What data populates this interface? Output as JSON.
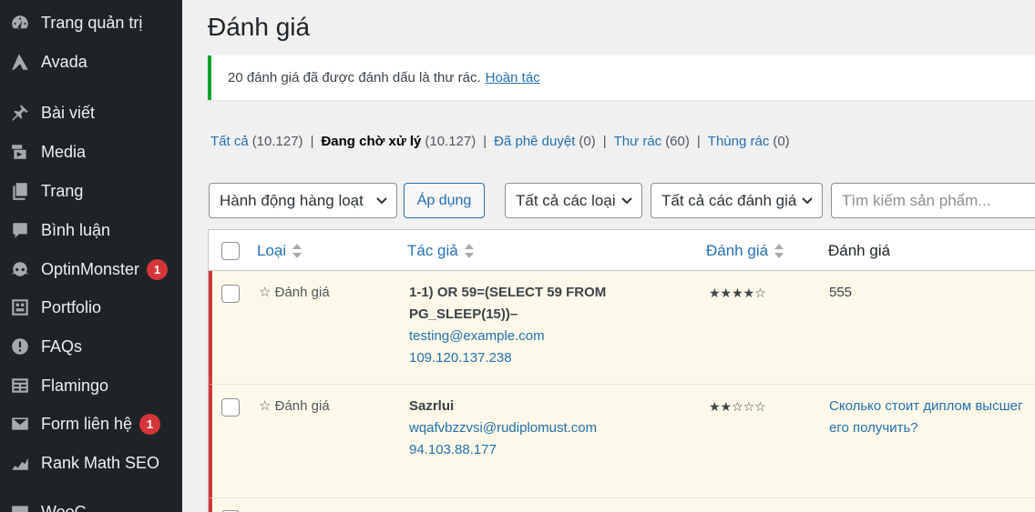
{
  "sidebar": {
    "items": [
      {
        "label": "Trang quản trị",
        "icon": "dashboard-icon"
      },
      {
        "label": "Avada",
        "icon": "avada-icon"
      },
      {
        "label": "Bài viết",
        "icon": "pin-icon"
      },
      {
        "label": "Media",
        "icon": "media-icon"
      },
      {
        "label": "Trang",
        "icon": "pages-icon"
      },
      {
        "label": "Bình luận",
        "icon": "comments-icon"
      },
      {
        "label": "OptinMonster",
        "icon": "optinmonster-icon",
        "badge": "1"
      },
      {
        "label": "Portfolio",
        "icon": "portfolio-icon"
      },
      {
        "label": "FAQs",
        "icon": "faq-icon"
      },
      {
        "label": "Flamingo",
        "icon": "flamingo-icon"
      },
      {
        "label": "Form liên hệ",
        "icon": "mail-icon",
        "badge": "1"
      },
      {
        "label": "Rank Math SEO",
        "icon": "rankmath-icon"
      },
      {
        "label": "WooC",
        "icon": "woo-icon"
      }
    ]
  },
  "page": {
    "title": "Đánh giá",
    "notice_text": "20 đánh giá đã được đánh dấu là thư rác.",
    "notice_undo": "Hoàn tác"
  },
  "filters": {
    "all_label": "Tất cả",
    "all_count": "(10.127)",
    "pending_label": "Đang chờ xử lý",
    "pending_count": "(10.127)",
    "approved_label": "Đã phê duyệt",
    "approved_count": "(0)",
    "spam_label": "Thư rác",
    "spam_count": "(60)",
    "trash_label": "Thùng rác",
    "trash_count": "(0)",
    "separator": "|"
  },
  "toolbar": {
    "bulk_action": "Hành động hàng loạt",
    "apply": "Áp dụng",
    "type_filter": "Tất cả các loại",
    "rating_filter": "Tất cả các đánh giá",
    "search_placeholder": "Tìm kiếm sản phẩm..."
  },
  "table": {
    "columns": {
      "type": "Loại",
      "author": "Tác giả",
      "rating": "Đánh giá",
      "review": "Đánh giá"
    },
    "rows": [
      {
        "type": "☆ Đánh giá",
        "author_line1": "1-1) OR 59=(SELECT 59 FROM",
        "author_line2": "PG_SLEEP(15))–",
        "email": "testing@example.com",
        "ip": "109.120.137.238",
        "stars": "★★★★☆",
        "stars_value": 4,
        "review": "555"
      },
      {
        "type": "☆ Đánh giá",
        "author_line1": "Sazrlui",
        "email": "wqafvbzzvsi@rudiplomust.com",
        "ip": "94.103.88.177",
        "stars": "★★☆☆☆",
        "stars_value": 2,
        "review_line1": "Сколько стоит диплом высшег",
        "review_line2": "его получить?"
      }
    ]
  }
}
